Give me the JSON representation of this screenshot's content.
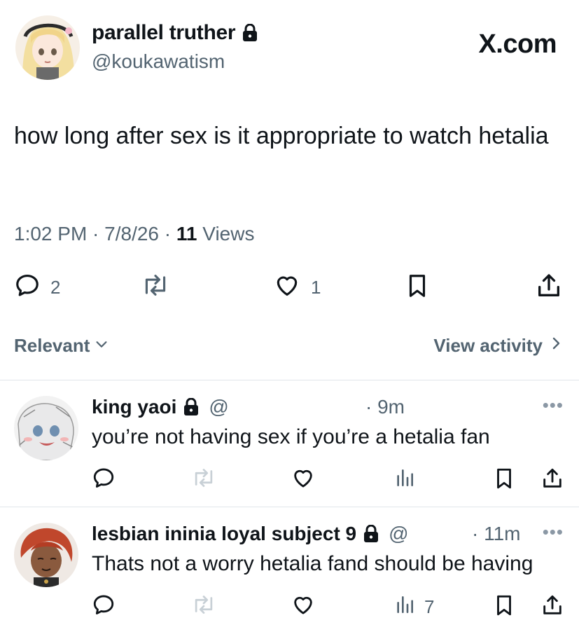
{
  "post": {
    "author_name": "parallel truther",
    "author_handle": "@koukawatism",
    "brand": "X.com",
    "text": "how long after sex is it appropriate to watch hetalia",
    "time": "1:02 PM · 7/8/26 · ",
    "views_count": "11",
    "views_label": " Views",
    "replies": "2",
    "likes": "1"
  },
  "sort": {
    "relevant_label": "Relevant",
    "view_activity_label": "View activity"
  },
  "replies": [
    {
      "name": "king yaoi",
      "handle": "@",
      "time": "· 9m",
      "text": "you’re not having sex if you’re a hetalia fan",
      "views": ""
    },
    {
      "name": "lesbian ininia loyal subject 9",
      "handle": "@",
      "time": "· 11m",
      "text": "Thats not a worry hetalia fand should be having",
      "views": "7"
    }
  ],
  "colors": {
    "text": "#0f1419",
    "muted": "#536471",
    "faint": "#c8d0d6",
    "divider": "#e1e6ea"
  },
  "icons": [
    "lock-icon",
    "reply-icon",
    "retweet-icon",
    "like-icon",
    "bookmark-icon",
    "share-icon",
    "views-icon",
    "chevron-down-icon",
    "chevron-right-icon",
    "more-icon"
  ]
}
